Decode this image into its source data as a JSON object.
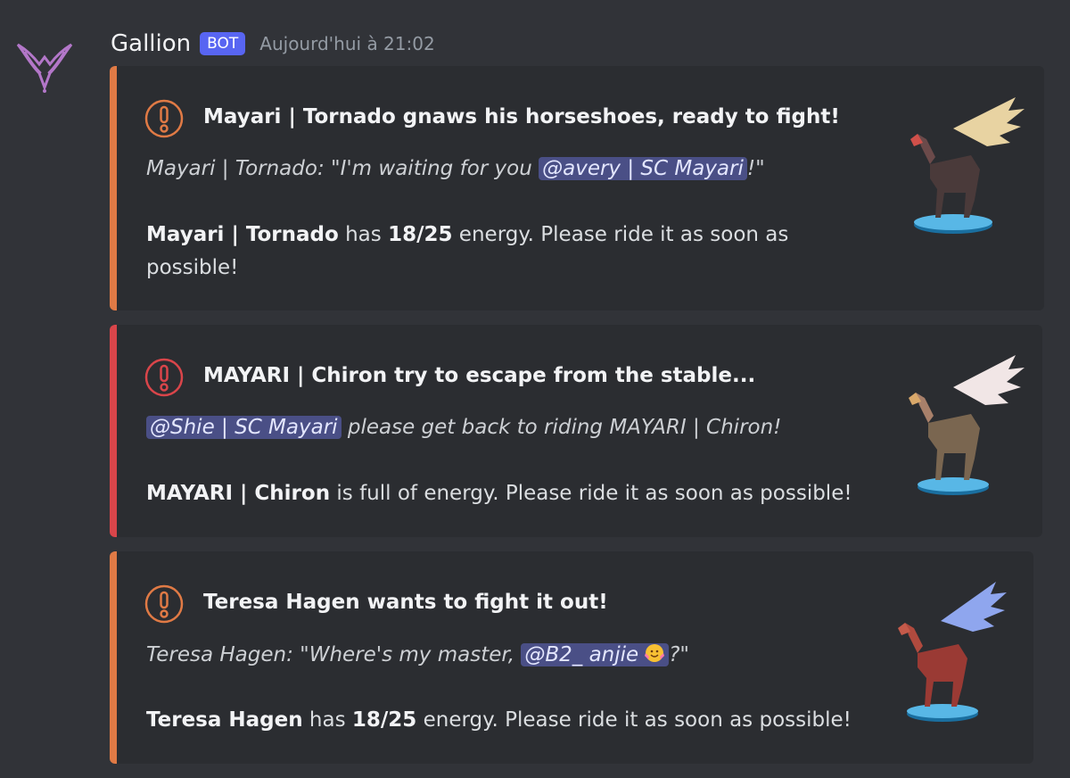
{
  "author": {
    "name": "Gallion",
    "badge": "BOT",
    "timestamp": "Aujourd'hui à 21:02"
  },
  "embeds": [
    {
      "accent": "#e07a45",
      "title": "Mayari | Tornado gnaws his horseshoes, ready to fight!",
      "quote_prefix": "Mayari | Tornado: \"I'm waiting for you ",
      "mention": "@avery | SC Mayari",
      "quote_suffix": "!\"",
      "horse_name": "Mayari | Tornado",
      "text_has": " has ",
      "energy": "18/25",
      "text_rest_line1": " energy. Please ride it as soon as",
      "text_rest_line2": "possible!"
    },
    {
      "accent": "#d9454a",
      "title": "MAYARI | Chiron try to escape from the stable...",
      "mention": "@Shie | SC Mayari",
      "quote_suffix": " please get back to riding MAYARI | Chiron!",
      "horse_name": "MAYARI | Chiron",
      "text_rest": " is full of energy. Please ride it as soon as possible!"
    },
    {
      "accent": "#e07a45",
      "title": "Teresa Hagen wants to fight it out!",
      "quote_prefix": "Teresa Hagen: \"Where's my master, ",
      "mention": "@B2_ anjie",
      "quote_suffix": "?\"",
      "horse_name": "Teresa Hagen",
      "text_has": " has ",
      "energy": "18/25",
      "text_rest": " energy. Please ride it as soon as possible!"
    }
  ]
}
